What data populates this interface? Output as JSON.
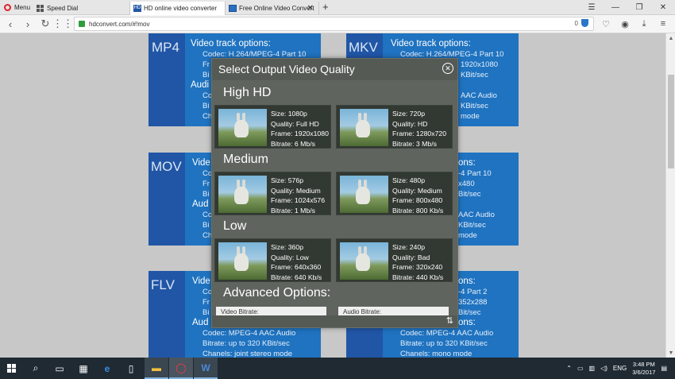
{
  "browser": {
    "menu_label": "Menu",
    "tabs": [
      {
        "title": "Speed Dial"
      },
      {
        "title": "HD online video converter"
      },
      {
        "title": "Free Online Video Convert"
      }
    ],
    "url": "hdconvert.com/#!mov",
    "url_badge_count": "0",
    "icons": {
      "back": "arrow-left-icon",
      "forward": "arrow-right-icon",
      "reload": "reload-icon",
      "speed_dial": "grid-icon",
      "lock": "lock-icon",
      "shield": "shield-icon",
      "heart": "heart-icon",
      "snapshot": "camera-icon",
      "download": "download-icon",
      "menu": "hamburger-icon"
    }
  },
  "cards": {
    "mp4": {
      "format": "MP4",
      "lines": [
        "Video track options:",
        "Codec: H.264/MPEG-4 Part 10",
        "Fr",
        "Bi",
        "Audi",
        "Co",
        "Bi",
        "Ch"
      ]
    },
    "mkv": {
      "format": "MKV",
      "lines": [
        "Video track options:",
        "Codec: H.264/MPEG-4 Part 10",
        "1920x1080",
        "KBit/sec",
        "AAC Audio",
        "KBit/sec",
        "mode"
      ]
    },
    "mov": {
      "format": "MOV",
      "lines": [
        "Vide",
        "Co",
        "Fr",
        "Bi",
        "Aud",
        "Co",
        "Bi",
        "Ch"
      ]
    },
    "mov_right": {
      "lines": [
        "ons:",
        "-4 Part 10",
        "x480",
        "Bit/sec",
        "AAC Audio",
        "KBit/sec",
        "mode"
      ]
    },
    "flv": {
      "format": "FLV",
      "lines": [
        "Vide",
        "Co",
        "Fr",
        "Bi",
        "Aud",
        "Codec: MPEG-4 AAC Audio",
        "Bitrate: up to 320 KBit/sec",
        "Chanels: joint stereo mode"
      ]
    },
    "flv_right": {
      "lines": [
        "ons:",
        "-4 Part 2",
        "352x288",
        "Bit/sec",
        "ons:",
        "Codec: MPEG-4 AAC Audio",
        "Bitrate: up to 320 KBit/sec",
        "Chanels: mono mode"
      ]
    }
  },
  "modal": {
    "title": "Select Output Video Quality",
    "sections": [
      {
        "heading": "High HD",
        "options": [
          {
            "size": "Size: 1080p",
            "quality": "Quality: Full HD",
            "frame": "Frame: 1920x1080",
            "bitrate": "Bitrate: 6 Mb/s"
          },
          {
            "size": "Size: 720p",
            "quality": "Quality: HD",
            "frame": "Frame: 1280x720",
            "bitrate": "Bitrate: 3 Mb/s"
          }
        ]
      },
      {
        "heading": "Medium",
        "options": [
          {
            "size": "Size: 576p",
            "quality": "Quality: Medium",
            "frame": "Frame: 1024x576",
            "bitrate": "Bitrate: 1 Mb/s"
          },
          {
            "size": "Size: 480p",
            "quality": "Quality: Medium",
            "frame": "Frame: 800x480",
            "bitrate": "Bitrate: 800 Kb/s"
          }
        ]
      },
      {
        "heading": "Low",
        "options": [
          {
            "size": "Size: 360p",
            "quality": "Quality: Low",
            "frame": "Frame: 640x360",
            "bitrate": "Bitrate: 640 Kb/s"
          },
          {
            "size": "Size: 240p",
            "quality": "Quality: Bad",
            "frame": "Frame: 320x240",
            "bitrate": "Bitrate: 440 Kb/s"
          }
        ]
      }
    ],
    "advanced_heading": "Advanced Options:",
    "video_bitrate_label": "Video Bitrate:",
    "audio_bitrate_label": "Audio Bitrate:"
  },
  "taskbar": {
    "language": "ENG",
    "time": "3:48 PM",
    "date": "3/6/2017"
  },
  "colors": {
    "card_blue": "#1f73c0",
    "card_strip": "#2156a6",
    "modal_bg": "#555a55",
    "taskbar_bg": "#1f2a33",
    "opera_red": "#e0222a"
  }
}
